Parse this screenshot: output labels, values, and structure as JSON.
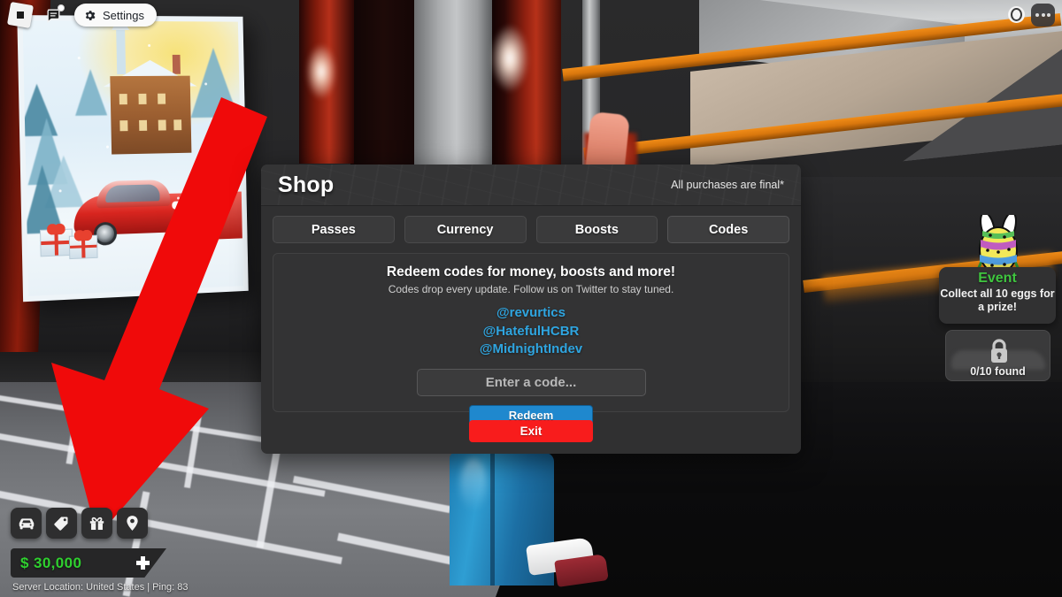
{
  "topbar": {
    "logo_icon": "roblox-logo-icon",
    "chat_icon": "chat-bubble-icon",
    "chat_badge": true,
    "settings_label": "Settings",
    "settings_icon": "gear-icon",
    "record_icon": "record-circle-icon",
    "menu_icon": "ellipsis-menu-icon"
  },
  "shop": {
    "title": "Shop",
    "disclaimer": "All purchases are final*",
    "tabs": [
      {
        "label": "Passes",
        "active": false
      },
      {
        "label": "Currency",
        "active": false
      },
      {
        "label": "Boosts",
        "active": false
      },
      {
        "label": "Codes",
        "active": true
      }
    ],
    "codes_panel": {
      "heading": "Redeem codes for money, boosts and more!",
      "subheading": "Codes drop every update. Follow us on Twitter to stay tuned.",
      "handles": [
        "@revurtics",
        "@HatefulHCBR",
        "@MidnightIndev"
      ],
      "handle_color": "#2fa5e0",
      "input_placeholder": "Enter a code...",
      "input_value": "",
      "redeem_label": "Redeem",
      "redeem_color": "#1f88ce"
    },
    "exit_label": "Exit",
    "exit_color": "#f81c1c"
  },
  "event": {
    "icon": "easter-egg-bunny-icon",
    "title": "Event",
    "title_color": "#3fc63f",
    "description": "Collect all 10 eggs for a prize!",
    "locked_reward": {
      "icon": "lock-icon",
      "count_label": "0/10 found"
    }
  },
  "hud": {
    "buttons": [
      {
        "name": "cars",
        "icon": "car-icon"
      },
      {
        "name": "shop",
        "icon": "price-tag-icon"
      },
      {
        "name": "rewards",
        "icon": "gift-icon"
      },
      {
        "name": "locations",
        "icon": "map-pin-icon"
      }
    ],
    "currency": {
      "symbol": "$",
      "amount": "30,000",
      "display": "$ 30,000",
      "color": "#2fd02f",
      "add_icon": "plus-icon"
    },
    "server_status": "Server Location: United States | Ping: 83"
  },
  "annotation": {
    "arrow": "red-down-left-arrow",
    "color": "#f00a0a",
    "points_to": "price-tag-icon"
  },
  "scene": {
    "poster": "winter-watercolor-red-sports-car-poster",
    "setting": "dealership-garage-interior"
  }
}
